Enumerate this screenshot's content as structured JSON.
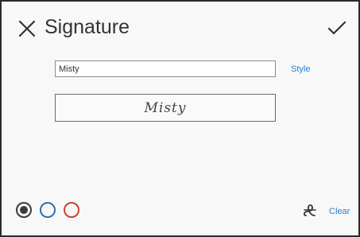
{
  "header": {
    "title": "Signature",
    "close_icon": "close-icon",
    "confirm_icon": "checkmark-icon"
  },
  "signature": {
    "name_value": "Misty",
    "style_label": "Style",
    "preview_text": "Misty"
  },
  "footer": {
    "colors": [
      {
        "name": "black",
        "hex": "#3a3a3a",
        "selected": true
      },
      {
        "name": "blue",
        "hex": "#2f6fb8",
        "selected": false
      },
      {
        "name": "red",
        "hex": "#c8442f",
        "selected": false
      }
    ],
    "font_icon": "handwriting-font-icon",
    "clear_label": "Clear"
  },
  "colors": {
    "accent_link": "#2a7fd4",
    "text": "#333333"
  }
}
